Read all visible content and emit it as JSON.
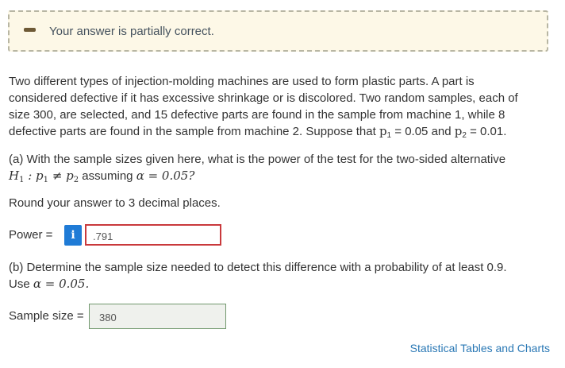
{
  "banner": {
    "message": "Your answer is partially correct."
  },
  "problem": {
    "line1": "Two different types of injection-molding machines are used to form plastic parts. A part is",
    "line2": "considered defective if it has excessive shrinkage or is discolored. Two random samples, each of",
    "line3": "size 300, are selected, and 15 defective parts are found in the sample from machine 1, while 8",
    "line4_pre": "defective parts are found in the sample from machine 2. Suppose that ",
    "p1_var": "p",
    "p1_sub": "1",
    "p1_val": " = 0.05 and ",
    "p2_var": "p",
    "p2_sub": "2",
    "p2_val": " = 0.01."
  },
  "part_a": {
    "question": "(a) With the sample sizes given here, what is the power of the test for the two-sided alternative",
    "h1": "H",
    "h1_sub": "1",
    "h1_body": " : p",
    "h1_p1sub": "1",
    "neq": " ≠ p",
    "h1_p2sub": "2",
    "assuming": " assuming ",
    "alpha_eq": "α = 0.05?",
    "round_note": "Round your answer to 3 decimal places.",
    "power_label": "Power =",
    "info_icon": "i",
    "power_value": ".791"
  },
  "part_b": {
    "question": "(b) Determine the sample size needed to detect this difference with a probability of at least 0.9.",
    "use_text": "Use ",
    "alpha_eq": "α = 0.05.",
    "sample_label": "Sample size =",
    "sample_value": "380"
  },
  "footer": {
    "link": "Statistical Tables and Charts"
  }
}
